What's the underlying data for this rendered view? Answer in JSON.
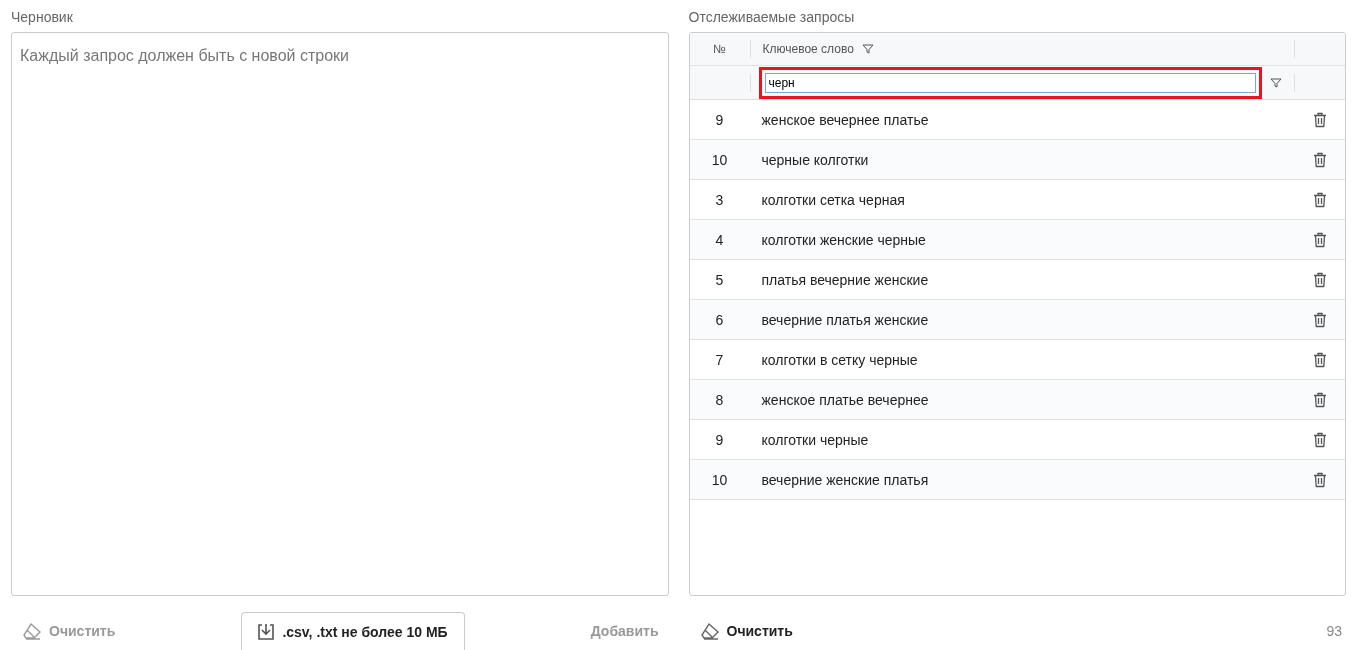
{
  "draft": {
    "title": "Черновик",
    "placeholder": "Каждый запрос должен быть с новой строки",
    "buttons": [
      {
        "kind": "clear",
        "label": "Очистить",
        "disabled": true
      },
      {
        "kind": "upload",
        "label": ".csv, .txt не более 10 МБ",
        "disabled": false
      },
      {
        "kind": "add",
        "label": "Добавить",
        "disabled": true
      }
    ]
  },
  "tracked": {
    "title": "Отслеживаемые запросы",
    "columns": [
      "№",
      "Ключевое слово"
    ],
    "filter": {
      "value": "черн",
      "highlighted": true
    },
    "rows": [
      {
        "num": "9",
        "keyword": "женское вечернее платье"
      },
      {
        "num": "10",
        "keyword": "черные колготки"
      },
      {
        "num": "3",
        "keyword": "колготки сетка черная"
      },
      {
        "num": "4",
        "keyword": "колготки женские черные"
      },
      {
        "num": "5",
        "keyword": "платья вечерние женские"
      },
      {
        "num": "6",
        "keyword": "вечерние платья женские"
      },
      {
        "num": "7",
        "keyword": "колготки в сетку черные"
      },
      {
        "num": "8",
        "keyword": "женское платье вечернее"
      },
      {
        "num": "9",
        "keyword": "колготки черные"
      },
      {
        "num": "10",
        "keyword": "вечерние женские платья"
      }
    ],
    "clear": {
      "label": "Очистить",
      "disabled": false
    },
    "count": "93"
  }
}
